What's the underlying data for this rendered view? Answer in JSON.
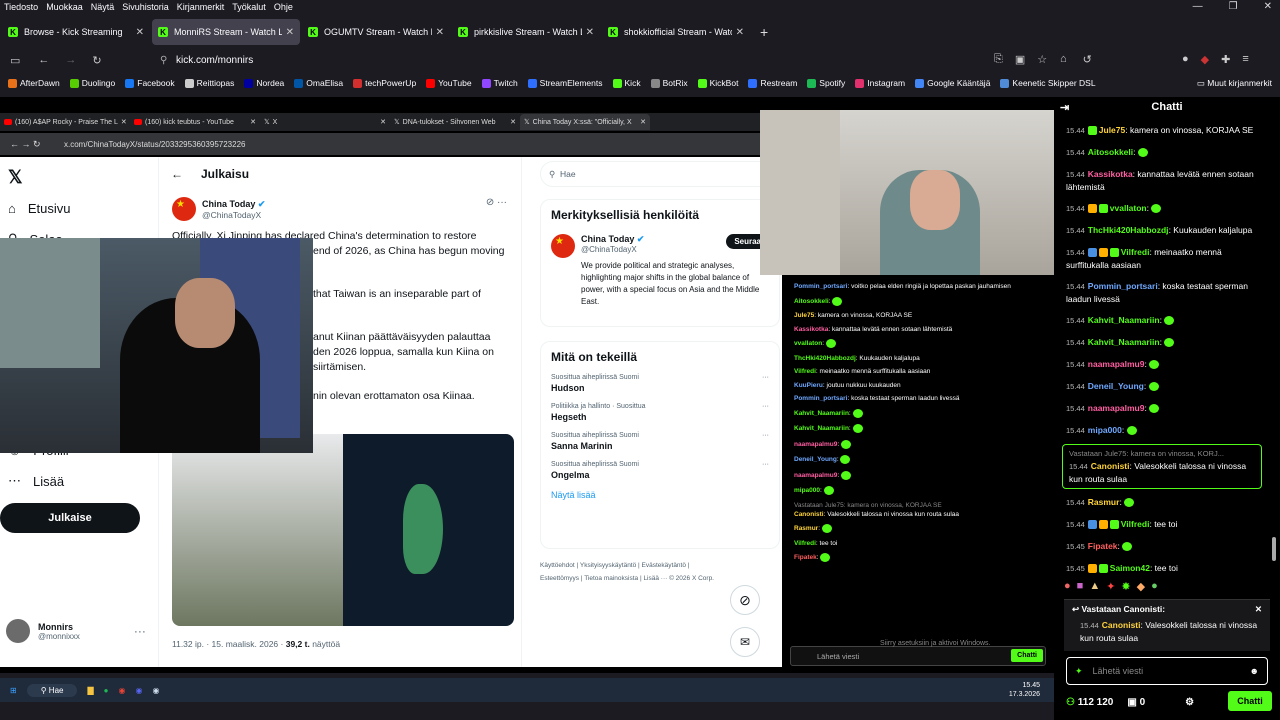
{
  "menubar": {
    "items": [
      "Tiedosto",
      "Muokkaa",
      "Näytä",
      "Sivuhistoria",
      "Kirjanmerkit",
      "Työkalut",
      "Ohje"
    ]
  },
  "tabs": [
    {
      "title": "Browse - Kick Streaming",
      "active": false
    },
    {
      "title": "MonniRS Stream - Watch L",
      "active": true
    },
    {
      "title": "OGUMTV Stream - Watch L",
      "active": false
    },
    {
      "title": "pirkkislive Stream - Watch L",
      "active": false
    },
    {
      "title": "shokkiofficial Stream - Watc",
      "active": false
    }
  ],
  "nav": {
    "url": "kick.com/monnirs"
  },
  "bookmarks": [
    {
      "label": "AfterDawn",
      "color": "#e8711a"
    },
    {
      "label": "Duolingo",
      "color": "#58cc02"
    },
    {
      "label": "Facebook",
      "color": "#1877f2"
    },
    {
      "label": "Reittiopas",
      "color": "#cccccc"
    },
    {
      "label": "Nordea",
      "color": "#0000a0"
    },
    {
      "label": "OmaElisa",
      "color": "#0055a5"
    },
    {
      "label": "techPowerUp",
      "color": "#d32f2f"
    },
    {
      "label": "YouTube",
      "color": "#ff0000"
    },
    {
      "label": "Twitch",
      "color": "#9146ff"
    },
    {
      "label": "StreamElements",
      "color": "#2f6fff"
    },
    {
      "label": "Kick",
      "color": "#53fc18"
    },
    {
      "label": "BotRix",
      "color": "#888888"
    },
    {
      "label": "KickBot",
      "color": "#53fc18"
    },
    {
      "label": "Restream",
      "color": "#2f6fff"
    },
    {
      "label": "Spotify",
      "color": "#1db954"
    },
    {
      "label": "Instagram",
      "color": "#e1306c"
    },
    {
      "label": "Google Kääntäjä",
      "color": "#4285f4"
    },
    {
      "label": "Keenetic Skipper DSL",
      "color": "#4f8bd6"
    }
  ],
  "bookmarks_other": "Muut kirjanmerkit",
  "inner_tabs": [
    "(160) A$AP Rocky - Praise The L",
    "(160) kick teubtus - YouTube",
    "X",
    "DNA-tulokset - Sihvonen Web",
    "China Today X:ssä: \"Officially, X"
  ],
  "inner_url": "x.com/ChinaTodayX/status/2033295360395723226",
  "x": {
    "nav": [
      "Etusivu",
      "Selaa",
      "Profiili",
      "Lisää"
    ],
    "post_button": "Julkaise",
    "user_name": "Monnirs",
    "user_handle": "@monnixxx",
    "header": "Julkaisu",
    "author_name": "China Today",
    "author_handle": "@ChinaTodayX",
    "tweet_lines": [
      "Officially, Xi Jinping has declared China's determination to restore",
      "end of 2026, as China has begun moving",
      "that Taiwan is an inseparable part of",
      "anut Kiinan päättäväisyyden palauttaa",
      "den 2026 loppua, samalla kun Kiina on",
      "siirtämisen.",
      "nin olevan erottamaton osa Kiinaa."
    ],
    "tweet_meta": "11.32 ip. · 15. maalisk. 2026 · ",
    "views": "39,2 t.",
    "views_label": "näyttöä",
    "search_placeholder": "Hae",
    "who_title": "Merkityksellisiä henkilöitä",
    "follow": "Seuraa",
    "who_bio": "We provide political and strategic analyses, highlighting major shifts in the global balance of power, with a special focus on Asia and the Middle East.",
    "trends_title": "Mitä on tekeillä",
    "trends": [
      {
        "context": "Suosittua aiheplirissä Suomi",
        "name": "Hudson"
      },
      {
        "context": "Politiikka ja hallinto · Suosittua",
        "name": "Hegseth"
      },
      {
        "context": "Suosittua aiheplirissä Suomi",
        "name": "Sanna Marinin"
      },
      {
        "context": "Suosittua aiheplirissä Suomi",
        "name": "Ongelma"
      }
    ],
    "show_more": "Näytä lisää",
    "footer": "Käyttöehdot | Yksityisyyskäytäntö | Evästekäytäntö | Esteettömyys | Tietoa mainoksista | Lisää ··· © 2026 X Corp."
  },
  "overlay_chat": [
    {
      "user": "Pommin_portsari",
      "color": "#6fa8ff",
      "text": "voitko pelaa elden ringiä ja lopettaa paskan jauhamisen"
    },
    {
      "user": "Aitosokkeli",
      "color": "#53fc18",
      "text": ""
    },
    {
      "user": "Jule75",
      "color": "#ffd43b",
      "text": "kamera on vinossa, KORJAA SE"
    },
    {
      "user": "Kassikotka",
      "color": "#ff5fa2",
      "text": "kannattaa levätä ennen sotaan lähtemistä"
    },
    {
      "user": "vvallaton",
      "color": "#53fc18",
      "text": ""
    },
    {
      "user": "ThcHki420Habbozdj",
      "color": "#53fc18",
      "text": "Kuukauden kaljalupa"
    },
    {
      "user": "Vilfredi",
      "color": "#53fc18",
      "text": "meinaatko mennä surffitukalla aasiaan"
    },
    {
      "user": "KuuPieru",
      "color": "#6fa8ff",
      "text": "joutuu nukkuu kuukauden"
    },
    {
      "user": "Pommin_portsari",
      "color": "#6fa8ff",
      "text": "koska testaat sperman laadun livessä"
    },
    {
      "user": "Kahvit_Naamariin",
      "color": "#53fc18",
      "text": ""
    },
    {
      "user": "Kahvit_Naamariin",
      "color": "#53fc18",
      "text": ""
    },
    {
      "user": "naamapalmu9",
      "color": "#ff5fa2",
      "text": ""
    },
    {
      "user": "Deneil_Young",
      "color": "#6fa8ff",
      "text": ""
    },
    {
      "user": "naamapalmu9",
      "color": "#ff5fa2",
      "text": ""
    },
    {
      "user": "mipa000",
      "color": "#53fc18",
      "text": ""
    },
    {
      "user": "Canonisti",
      "color": "#ffd43b",
      "text": "Valesokkeli talossa ni vinossa kun routa sulaa"
    },
    {
      "user": "Rasmur",
      "color": "#ffd43b",
      "text": ""
    },
    {
      "user": "Vilfredi",
      "color": "#53fc18",
      "text": "tee toi"
    },
    {
      "user": "Fipatek",
      "color": "#ff5f5f",
      "text": ""
    }
  ],
  "overlay_input": "Lähetä viesti",
  "overlay_chat_btn": "Chatti",
  "overlay_reply": "Vastataan Jule75: kamera on vinossa, KORJAA SE",
  "windows_watermark": "Siirry asetuksiin ja aktivoi Windows.",
  "taskbar": {
    "search": "Hae",
    "time": "15.45",
    "date": "17.3.2026"
  },
  "chat": {
    "title": "Chatti",
    "messages": [
      {
        "time": "15.44",
        "user": "Jule75",
        "color": "#ffd43b",
        "text": "kamera on vinossa, KORJAA SE",
        "badges": [
          "#53fc18"
        ]
      },
      {
        "time": "15.44",
        "user": "Aitosokkeli",
        "color": "#53fc18",
        "text": "",
        "emote": true
      },
      {
        "time": "15.44",
        "user": "Kassikotka",
        "color": "#ff5fa2",
        "text": "kannattaa levätä ennen sotaan lähtemistä"
      },
      {
        "time": "15.44",
        "user": "vvallaton",
        "color": "#53fc18",
        "text": "",
        "emote": true,
        "badges": [
          "#ffb000",
          "#53fc18"
        ]
      },
      {
        "time": "15.44",
        "user": "ThcHki420Habbozdj",
        "color": "#53fc18",
        "text": "Kuukauden kaljalupa"
      },
      {
        "time": "15.44",
        "user": "Vilfredi",
        "color": "#53fc18",
        "text": "meinaatko mennä surffitukalla aasiaan",
        "badges": [
          "#4a90e2",
          "#ffb000",
          "#53fc18"
        ]
      },
      {
        "time": "15.44",
        "user": "Pommin_portsari",
        "color": "#6fa8ff",
        "text": "koska testaat sperman laadun livessä"
      },
      {
        "time": "15.44",
        "user": "Kahvit_Naamariin",
        "color": "#53fc18",
        "text": "",
        "emote": true
      },
      {
        "time": "15.44",
        "user": "Kahvit_Naamariin",
        "color": "#53fc18",
        "text": "",
        "emote": true
      },
      {
        "time": "15.44",
        "user": "naamapalmu9",
        "color": "#ff5fa2",
        "text": "",
        "emote": true
      },
      {
        "time": "15.44",
        "user": "Deneil_Young",
        "color": "#6fa8ff",
        "text": "",
        "emote": true
      },
      {
        "time": "15.44",
        "user": "naamapalmu9",
        "color": "#ff5fa2",
        "text": "",
        "emote": true
      },
      {
        "time": "15.44",
        "user": "mipa000",
        "color": "#6fa8ff",
        "text": "",
        "emote": true
      }
    ],
    "reply_header": "Vastataan Jule75: kamera on vinossa, KORJ...",
    "reply_time": "15.44",
    "reply_user": "Canonisti",
    "reply_text": "Valesokkeli talossa ni vinossa kun routa sulaa",
    "after": [
      {
        "time": "15.44",
        "user": "Rasmur",
        "color": "#ffd43b",
        "text": "",
        "emote": true
      },
      {
        "time": "15.44",
        "user": "Vilfredi",
        "color": "#53fc18",
        "text": "tee toi",
        "badges": [
          "#4a90e2",
          "#ffb000",
          "#53fc18"
        ]
      },
      {
        "time": "15.45",
        "user": "Fipatek",
        "color": "#ff5f5f",
        "text": "",
        "emote": true
      },
      {
        "time": "15.45",
        "user": "Saimon42",
        "color": "#53fc18",
        "text": "tee toi",
        "badges": [
          "#ffb000",
          "#53fc18"
        ]
      }
    ],
    "replying_label": "Vastataan Canonisti:",
    "replying_time": "15.44",
    "replying_user": "Canonisti",
    "replying_text": "Valesokkeli talossa ni vinossa kun routa sulaa",
    "input_placeholder": "Lähetä viesti",
    "viewer_count": "112 120",
    "kicks": "0",
    "chat_button": "Chatti"
  }
}
